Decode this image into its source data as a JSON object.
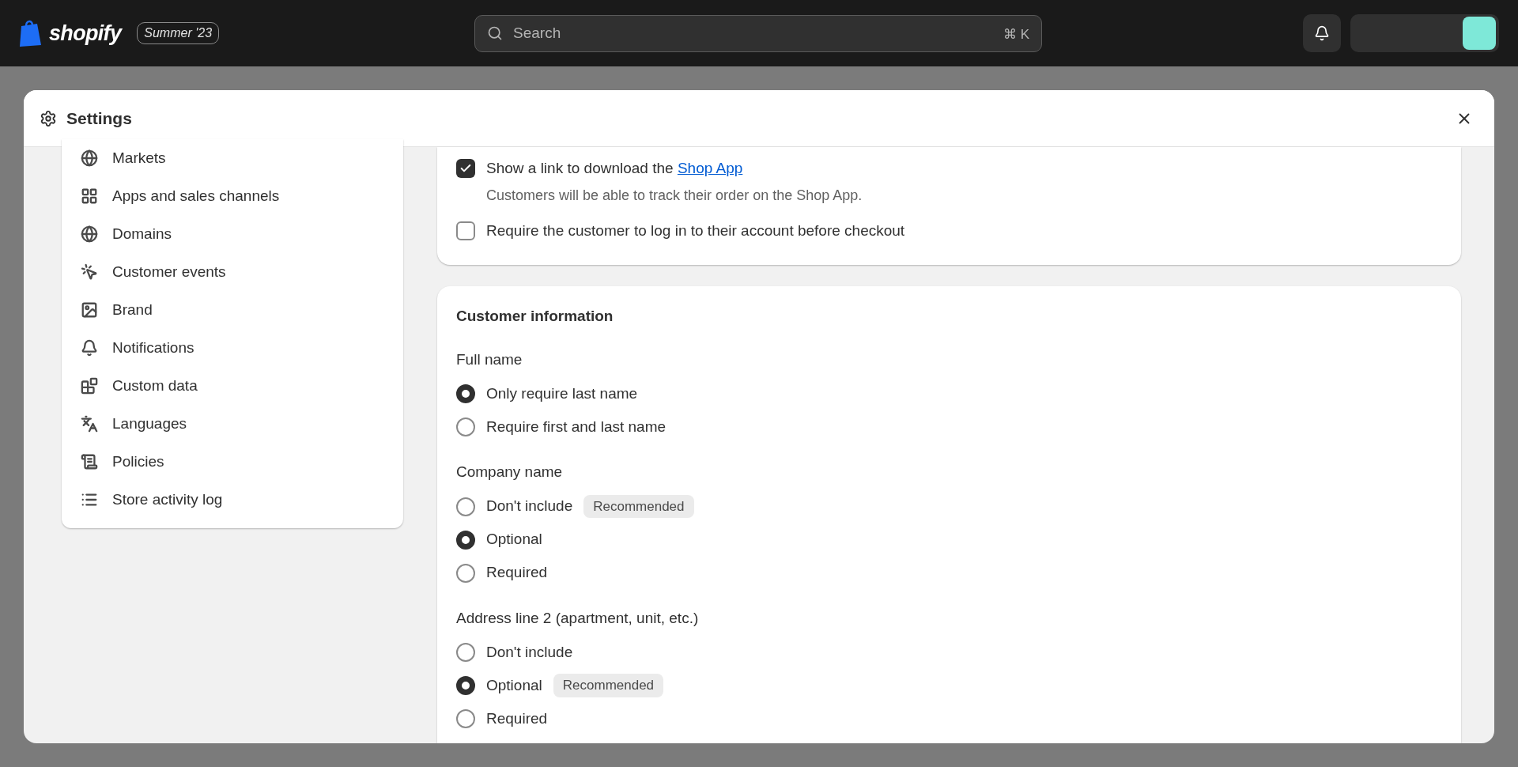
{
  "topbar": {
    "brand": "shopify",
    "edition": "Summer '23",
    "search": {
      "placeholder": "Search",
      "shortcut": "⌘ K"
    }
  },
  "modal": {
    "title": "Settings"
  },
  "sidebar": {
    "items": [
      {
        "label": "Markets",
        "kind": "markets"
      },
      {
        "label": "Apps and sales channels",
        "kind": "apps"
      },
      {
        "label": "Domains",
        "kind": "domains"
      },
      {
        "label": "Customer events",
        "kind": "events"
      },
      {
        "label": "Brand",
        "kind": "brand"
      },
      {
        "label": "Notifications",
        "kind": "notifications"
      },
      {
        "label": "Custom data",
        "kind": "data"
      },
      {
        "label": "Languages",
        "kind": "languages"
      },
      {
        "label": "Policies",
        "kind": "policies"
      },
      {
        "label": "Store activity log",
        "kind": "log"
      }
    ]
  },
  "checkout_options": [
    {
      "label": "Show a link to download the",
      "link": "Shop App",
      "checked": true,
      "help": "Customers will be able to track their order on the Shop App."
    },
    {
      "label": "Require the customer to log in to their account before checkout",
      "checked": false
    }
  ],
  "customer_information": {
    "title": "Customer information",
    "groups": [
      {
        "label": "Full name",
        "options": [
          {
            "label": "Only require last name",
            "selected": true
          },
          {
            "label": "Require first and last name",
            "selected": false
          }
        ]
      },
      {
        "label": "Company name",
        "options": [
          {
            "label": "Don't include",
            "selected": false,
            "badge": "Recommended"
          },
          {
            "label": "Optional",
            "selected": true
          },
          {
            "label": "Required",
            "selected": false
          }
        ]
      },
      {
        "label": "Address line 2 (apartment, unit, etc.)",
        "options": [
          {
            "label": "Don't include",
            "selected": false
          },
          {
            "label": "Optional",
            "selected": true,
            "badge": "Recommended"
          },
          {
            "label": "Required",
            "selected": false
          }
        ]
      }
    ]
  }
}
